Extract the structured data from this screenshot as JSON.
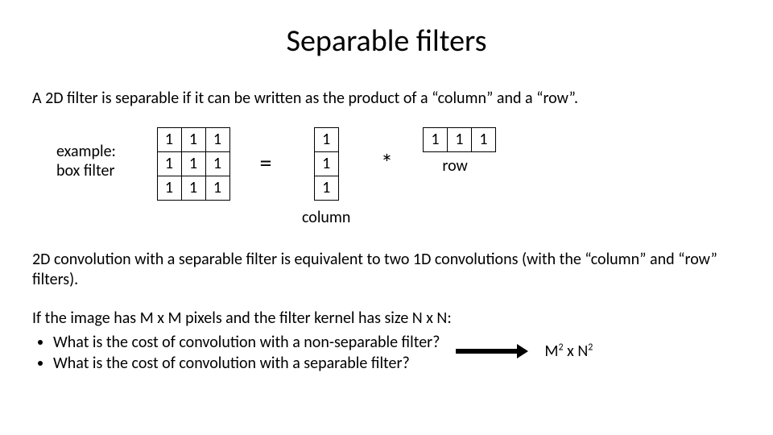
{
  "title": "Separable filters",
  "intro": "A 2D filter is separable if it can be written as the product of a “column” and a “row”.",
  "example_label_1": "example:",
  "example_label_2": "box filter",
  "box": {
    "r0c0": "1",
    "r0c1": "1",
    "r0c2": "1",
    "r1c0": "1",
    "r1c1": "1",
    "r1c2": "1",
    "r2c0": "1",
    "r2c1": "1",
    "r2c2": "1"
  },
  "equals": "=",
  "col_vec": {
    "c0": "1",
    "c1": "1",
    "c2": "1"
  },
  "column_caption": "column",
  "star": "*",
  "row_vec": {
    "r0": "1",
    "r1": "1",
    "r2": "1"
  },
  "row_caption": "row",
  "para": "2D convolution with a separable filter is equivalent to two 1D convolutions (with the “column” and “row” filters).",
  "q_intro": "If the image has M x M pixels and the filter kernel has size N x N:",
  "q1": "What is the cost of convolution with a non-separable filter?",
  "q2": "What is the cost of convolution with a separable filter?",
  "cost_m": "M",
  "cost_times": " x ",
  "cost_n": "N",
  "cost_sup": "2"
}
